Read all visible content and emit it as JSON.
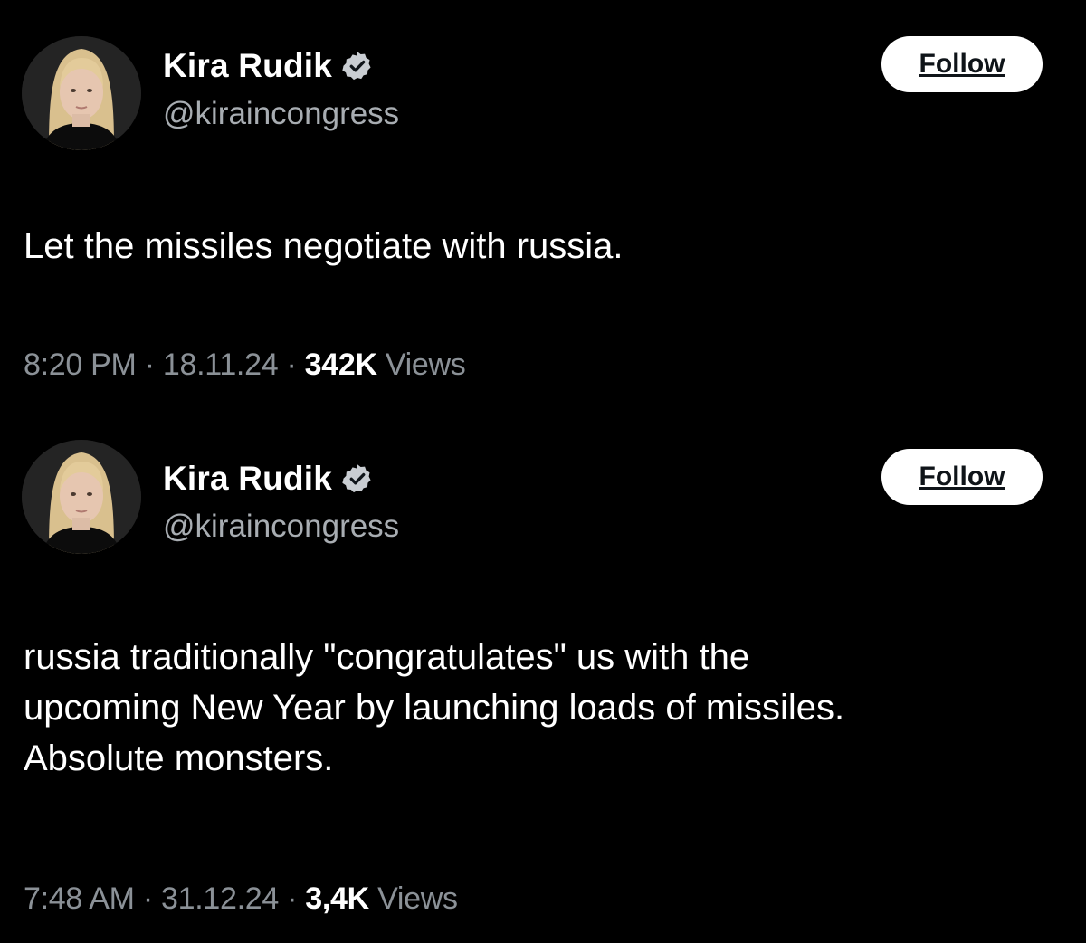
{
  "tweets": [
    {
      "display_name": "Kira Rudik",
      "handle": "@kiraincongress",
      "follow_label": "Follow",
      "text": "Let the missiles negotiate with russia.",
      "time": "8:20 PM",
      "date": "18.11.24",
      "separator": "·",
      "views_count": "342K",
      "views_label": "Views",
      "avatar_icon": "profile-photo",
      "verified_icon": "verified-badge-icon"
    },
    {
      "display_name": "Kira Rudik",
      "handle": "@kiraincongress",
      "follow_label": "Follow",
      "text": "russia traditionally \"congratulates\" us with the\nupcoming New Year by launching loads of missiles.\nAbsolute monsters.",
      "time": "7:48 AM",
      "date": "31.12.24",
      "separator": "·",
      "views_count": "3,4K",
      "views_label": "Views",
      "avatar_icon": "profile-photo",
      "verified_icon": "verified-badge-icon"
    }
  ],
  "colors": {
    "background": "#000000",
    "text_primary": "#ffffff",
    "text_secondary": "#8b9197",
    "verified_badge": "#c9cdd2",
    "follow_button_bg": "#ffffff",
    "follow_button_text": "#0f1419"
  }
}
